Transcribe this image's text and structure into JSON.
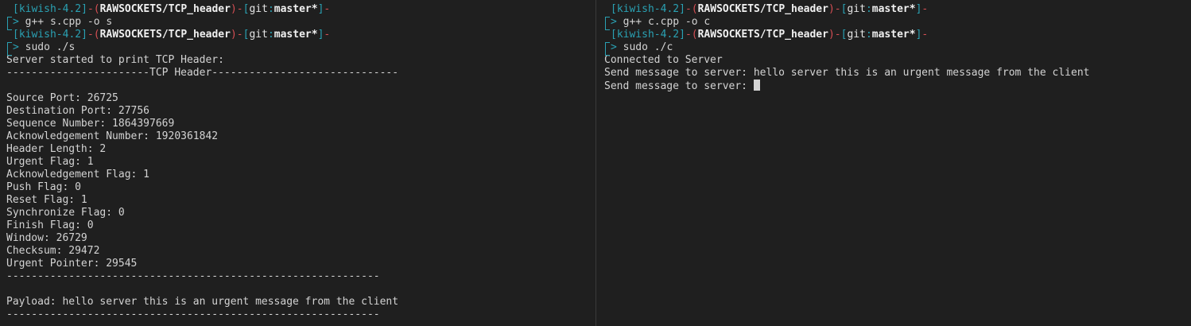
{
  "prompt": {
    "host": "kiwish-4.2",
    "path": "RAWSOCKETS/TCP_header",
    "git_label": "git",
    "branch": "master*",
    "arrow": ">"
  },
  "left_pane": {
    "cmd1": "g++ s.cpp -o s",
    "cmd2": "sudo ./s",
    "output": [
      "Server started to print TCP Header:",
      "-----------------------TCP Header------------------------------",
      "",
      "Source Port: 26725",
      "Destination Port: 27756",
      "Sequence Number: 1864397669",
      "Acknowledgement Number: 1920361842",
      "Header Length: 2",
      "Urgent Flag: 1",
      "Acknowledgement Flag: 1",
      "Push Flag: 0",
      "Reset Flag: 1",
      "Synchronize Flag: 0",
      "Finish Flag: 0",
      "Window: 26729",
      "Checksum: 29472",
      "Urgent Pointer: 29545",
      "------------------------------------------------------------",
      "",
      "Payload: hello server this is an urgent message from the client",
      "------------------------------------------------------------"
    ]
  },
  "right_pane": {
    "cmd1": "g++ c.cpp -o c",
    "cmd2": "sudo ./c",
    "output": [
      "Connected to Server",
      "Send message to server: hello server this is an urgent message from the client"
    ],
    "input_line": "Send message to server: "
  }
}
